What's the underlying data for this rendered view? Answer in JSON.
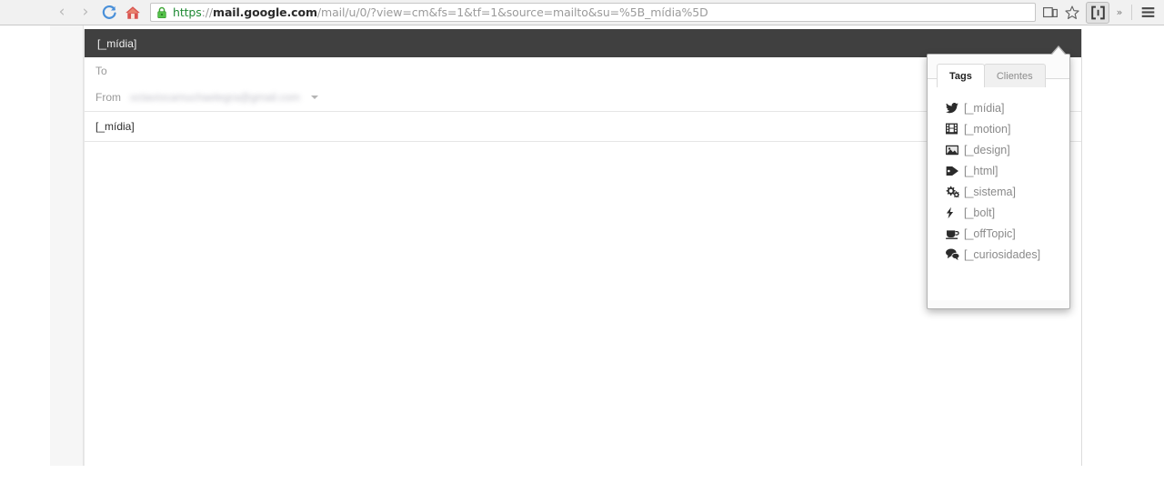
{
  "browser": {
    "nav": {
      "back_label": "‹",
      "forward_label": "›",
      "reload_name": "reload-icon",
      "home_name": "home-icon"
    },
    "omnibox": {
      "lock_name": "secure-lock-icon",
      "url_scheme": "https",
      "url_separator": "://",
      "url_host": "mail.google.com",
      "url_path": "/mail/u/0/?view=cm&fs=1&tf=1&source=mailto&su=%5B_mídia%5D",
      "full_url": "https://mail.google.com/mail/u/0/?view=cm&fs=1&tf=1&source=mailto&su=%5B_mídia%5D"
    },
    "toolbar_right": {
      "cast_icon": "mobile-device-icon",
      "bookmark_icon": "star-icon",
      "extension_icon": "brackets-extension-icon",
      "overflow_label": "»",
      "menu_icon": "hamburger-menu-icon"
    }
  },
  "compose": {
    "header_title": "[_mídia]",
    "to_label": "To",
    "to_value": "",
    "from_label": "From",
    "from_value": "octaviocamuchaelegra@gmail.com",
    "from_caret_name": "chevron-down-icon",
    "subject_value": "[_mídia]",
    "body_value": ""
  },
  "popup": {
    "tabs": [
      {
        "label": "Tags",
        "active": true
      },
      {
        "label": "Clientes",
        "active": false
      }
    ],
    "tags": [
      {
        "label": "[_mídia]",
        "icon": "twitter-bird-icon"
      },
      {
        "label": "[_motion]",
        "icon": "film-strip-icon"
      },
      {
        "label": "[_design]",
        "icon": "picture-image-icon"
      },
      {
        "label": "[_html]",
        "icon": "price-tag-icon"
      },
      {
        "label": "[_sistema]",
        "icon": "cogs-gears-icon"
      },
      {
        "label": "[_bolt]",
        "icon": "lightning-bolt-icon"
      },
      {
        "label": "[_offTopic]",
        "icon": "coffee-cup-icon"
      },
      {
        "label": "[_curiosidades]",
        "icon": "comments-bubbles-icon"
      }
    ]
  },
  "colors": {
    "toolbar_bg": "#f1f1f1",
    "compose_header_bg": "#404040",
    "secure_green": "#1f8a34",
    "reload_blue": "#4a90d9",
    "home_red": "#d9534f",
    "tag_label_gray": "#8a8a8a"
  }
}
